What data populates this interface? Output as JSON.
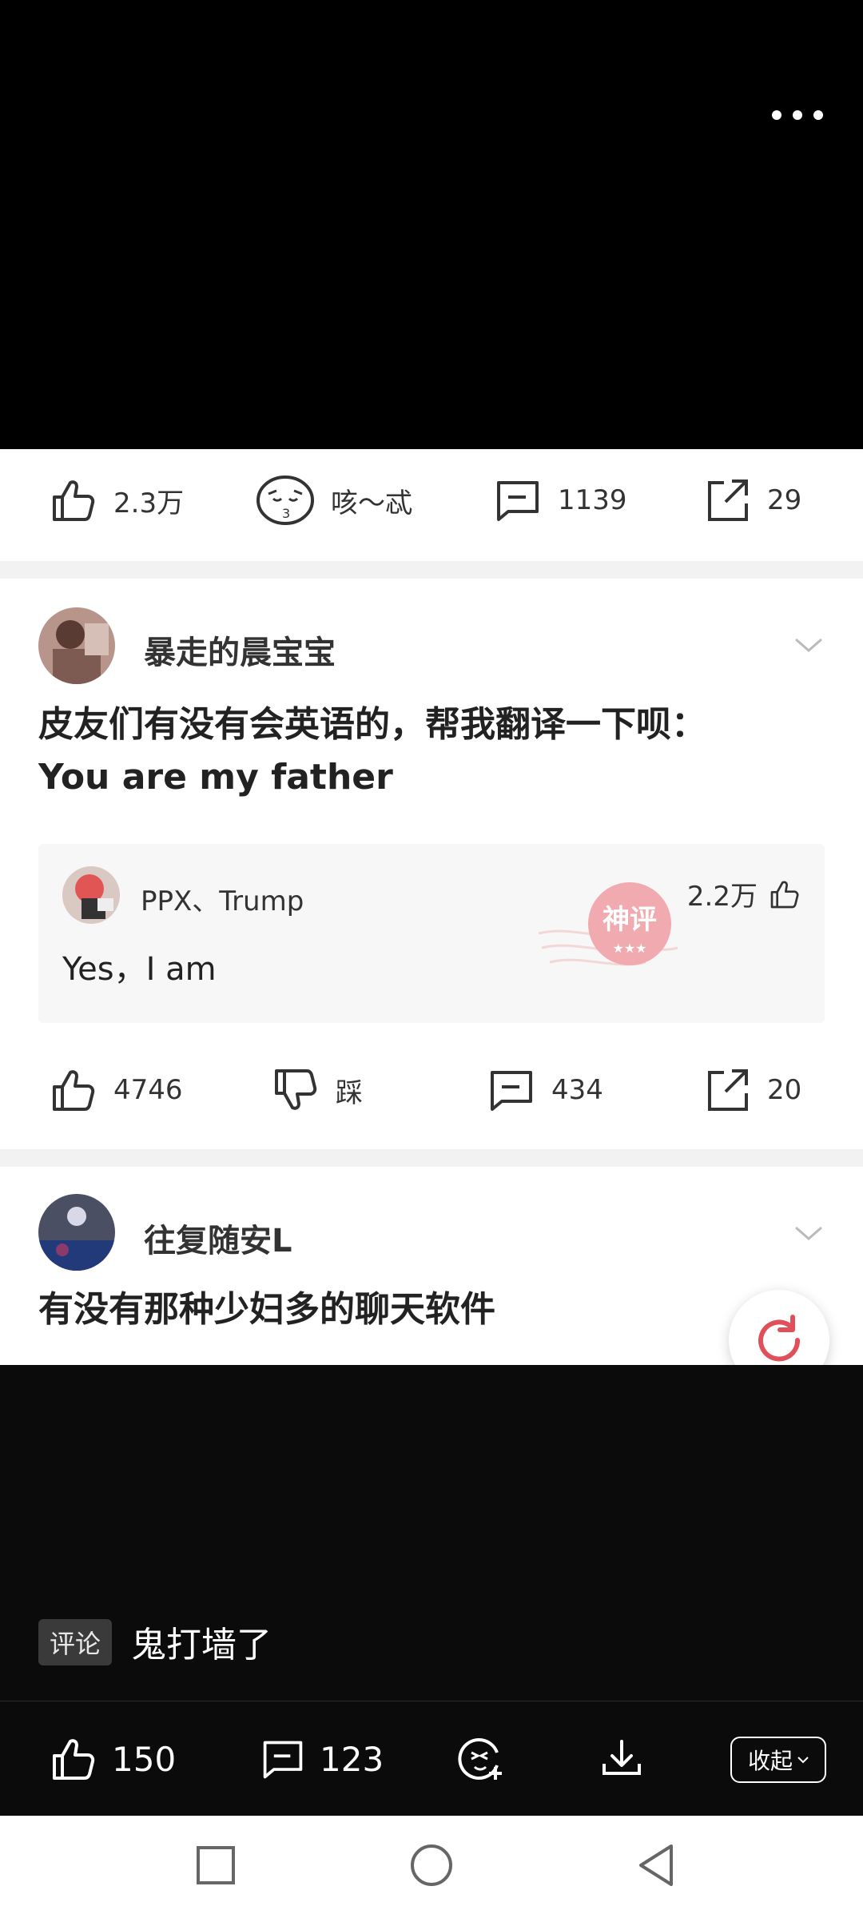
{
  "video_post": {
    "likes": "2.3万",
    "emoji_label": "咳～忒",
    "comments": "1139",
    "shares": "29"
  },
  "post1": {
    "username": "暴走的晨宝宝",
    "title_line1": "皮友们有没有会英语的，帮我翻译一下呗：",
    "title_line2": "You are my father",
    "god_comment": {
      "user": "PPX、Trump",
      "likes": "2.2万",
      "text": "Yes，I am",
      "stamp_text": "神评"
    },
    "likes": "4746",
    "dislike_label": "踩",
    "comments": "434",
    "shares": "20"
  },
  "post2": {
    "username": "往复随安L",
    "title": "有没有那种少妇多的聊天软件"
  },
  "video_overlay": {
    "comment_tag": "评论",
    "comment_text": "鬼打墙了"
  },
  "bottom_bar": {
    "likes": "150",
    "comments": "123",
    "collapse_label": "收起"
  },
  "icons": [
    "more-icon",
    "thumb-up-icon",
    "emoji-icon",
    "comment-icon",
    "share-icon",
    "thumb-down-icon",
    "chevron-down-icon",
    "refresh-icon",
    "add-emoji-icon",
    "download-icon",
    "square-nav-icon",
    "circle-nav-icon",
    "back-nav-icon"
  ]
}
